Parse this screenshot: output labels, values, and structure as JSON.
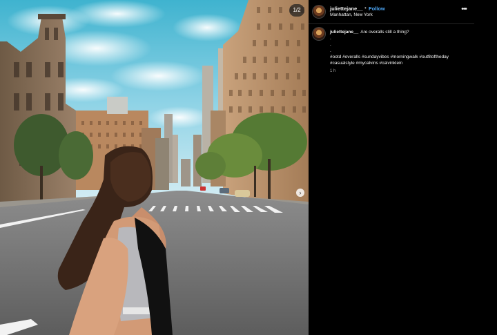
{
  "photo": {
    "counter": "1/2",
    "next_icon": "chevron-right-icon"
  },
  "post": {
    "username": "juliettejane__",
    "separator": "•",
    "follow_label": "Follow",
    "location": "Manhattan, New York",
    "more_icon": "more-horizontal-icon"
  },
  "caption": {
    "username": "juliettejane__",
    "text": "Are overalls still a thing?",
    "dot_lines": [
      ".",
      ".",
      "."
    ],
    "hashtags": "#ootd #overalls #sundayvibes #morningwalk #outfitoftheday #casualstyle #mycalvins #calvinklein",
    "time": "1 h"
  },
  "colors": {
    "background": "#000000",
    "follow_blue": "#4ca6f5",
    "text": "#f5f5f5",
    "muted": "#a8a8a8"
  }
}
